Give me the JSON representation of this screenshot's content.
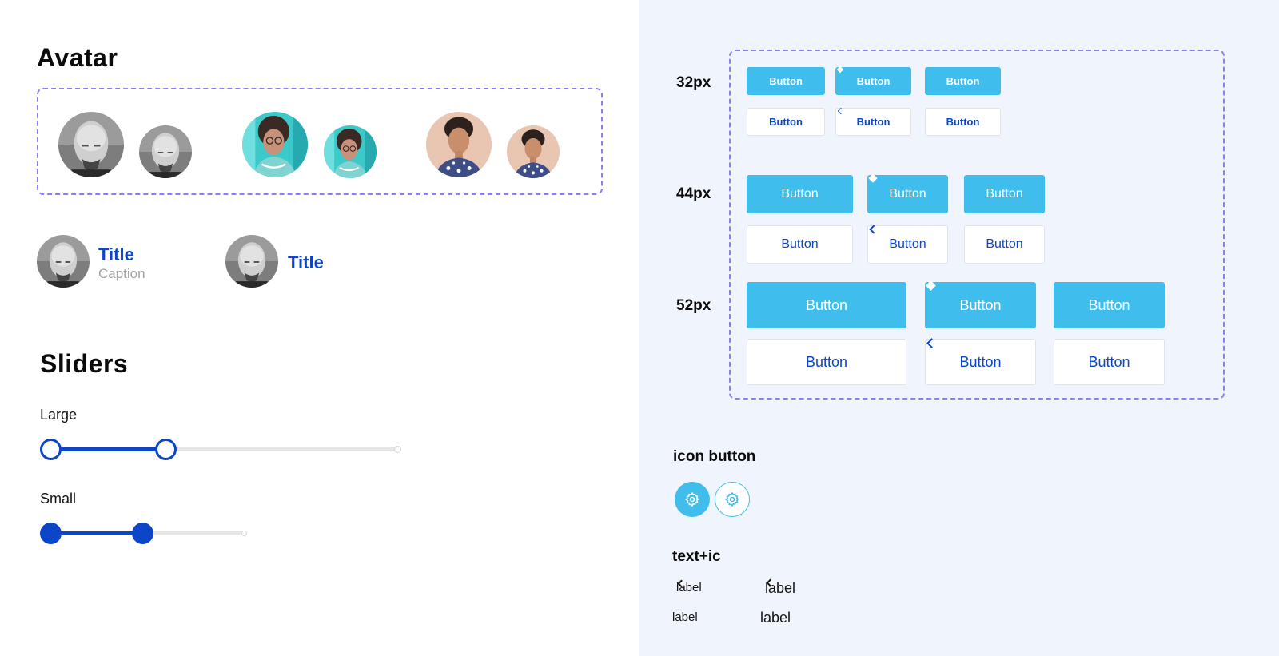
{
  "avatar_section": {
    "heading": "Avatar",
    "title_caption_item": {
      "title": "Title",
      "caption": "Caption"
    },
    "title_item": {
      "title": "Title"
    }
  },
  "sliders_section": {
    "heading": "Sliders",
    "large": {
      "label": "Large",
      "range_start": 0,
      "range_end": 0.35
    },
    "small": {
      "label": "Small",
      "range_start": 0,
      "range_end": 0.45
    }
  },
  "buttons_section": {
    "sizes": [
      {
        "label": "32px",
        "solid": [
          "Button",
          "Button",
          "Button"
        ],
        "outline": [
          "Button",
          "Button",
          "Button"
        ]
      },
      {
        "label": "44px",
        "solid": [
          "Button",
          "Button",
          "Button"
        ],
        "outline": [
          "Button",
          "Button",
          "Button"
        ]
      },
      {
        "label": "52px",
        "solid": [
          "Button",
          "Button",
          "Button"
        ],
        "outline": [
          "Button",
          "Button",
          "Button"
        ]
      }
    ]
  },
  "icon_button_section": {
    "heading": "icon button",
    "icon": "gear-icon"
  },
  "text_ic_section": {
    "heading": "text+ic",
    "items": [
      "label",
      "label",
      "label",
      "label"
    ]
  },
  "colors": {
    "accent_blue": "#0c45c7",
    "button_cyan": "#3fbdec",
    "dashed_border": "#8b7ff2",
    "right_panel_bg": "#f0f5fd"
  }
}
